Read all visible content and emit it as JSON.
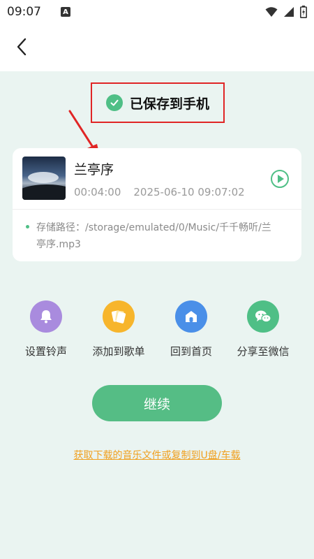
{
  "status_bar": {
    "time": "09:07",
    "notification_icon": "A"
  },
  "nav": {
    "back_icon": "chevron-left-icon"
  },
  "saved_banner": {
    "text": "已保存到手机",
    "highlight_color": "#e02525"
  },
  "song": {
    "title": "兰亭序",
    "duration": "00:04:00",
    "datetime": "2025-06-10 09:07:02",
    "path": "存储路径：/storage/emulated/0/Music/千千畅听/兰亭序.mp3"
  },
  "actions": [
    {
      "label": "设置铃声",
      "icon": "bell-icon",
      "color": "#a98bde"
    },
    {
      "label": "添加到歌单",
      "icon": "playlist-icon",
      "color": "#f7b52c"
    },
    {
      "label": "回到首页",
      "icon": "home-icon",
      "color": "#4a8fe8"
    },
    {
      "label": "分享至微信",
      "icon": "wechat-icon",
      "color": "#4fbf86"
    }
  ],
  "continue_button": {
    "label": "继续",
    "color": "#55bd85"
  },
  "bottom_link": {
    "text": "获取下载的音乐文件或复制到U盘/车载",
    "color": "#f0a020"
  }
}
